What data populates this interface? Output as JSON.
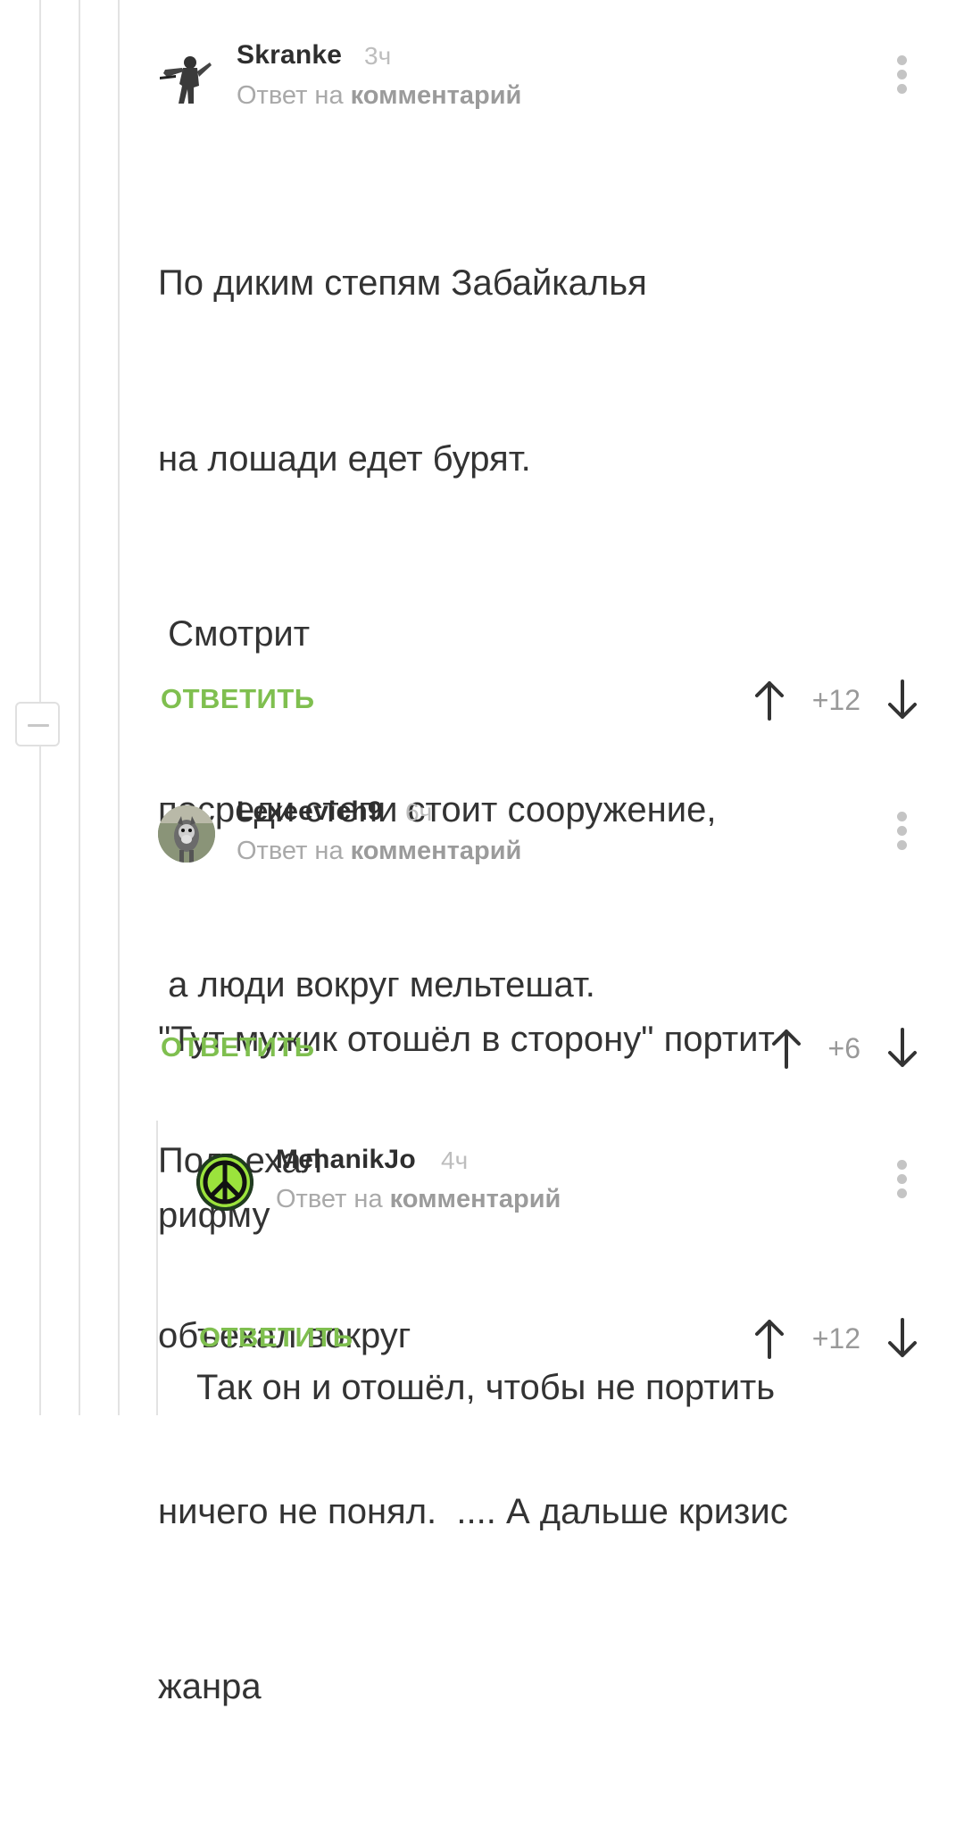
{
  "comments": [
    {
      "username": "Skranke",
      "time": "3ч",
      "reply_prefix": "Ответ на",
      "reply_target": "комментарий",
      "lines": [
        "По диким степям Забайкалья",
        "на лошади едет бурят.",
        " Смотрит",
        "посреди степи стоит сооружение,",
        " а люди вокруг мельтешат.",
        "Подъехал",
        "объехал вокруг",
        "ничего не понял.  .... А дальше кризис",
        "жанра"
      ],
      "reply_label": "ОТВЕТИТЬ",
      "rating": "+12",
      "avatar_icon": "soldier-silhouette"
    },
    {
      "username": "Lexeevich9",
      "time": "6ч",
      "reply_prefix": "Ответ на",
      "reply_target": "комментарий",
      "lines": [
        "\"Тут мужик отошёл в сторону\" портит",
        "рифму"
      ],
      "reply_label": "ОТВЕТИТЬ",
      "rating": "+6",
      "avatar_icon": "dog-photo"
    },
    {
      "username": "MehanikJo",
      "time": "4ч",
      "reply_prefix": "Ответ на",
      "reply_target": "комментарий",
      "lines": [
        "Так он и отошёл, чтобы не портить"
      ],
      "reply_label": "ОТВЕТИТЬ",
      "rating": "+12",
      "avatar_icon": "peace-symbol"
    }
  ],
  "colors": {
    "accent": "#7fbf4f",
    "muted": "#a9a9a9",
    "thread_line": "#e3e3e3"
  }
}
